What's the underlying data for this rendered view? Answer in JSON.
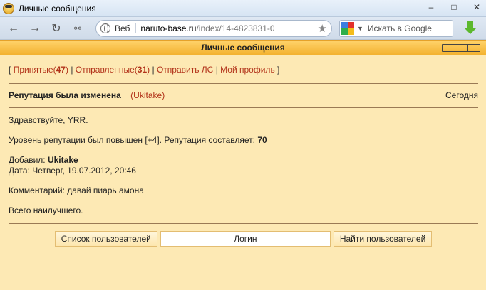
{
  "window": {
    "title": "Личные сообщения",
    "minimize": "–",
    "maximize": "□",
    "close": "✕"
  },
  "toolbar": {
    "url_label": "Веб",
    "url_host": "naruto-base.ru",
    "url_path": "/index/14-4823831-0",
    "search_placeholder": "Искать в Google"
  },
  "header": {
    "title": "Личные сообщения"
  },
  "nav": {
    "bracket_open": "[",
    "bracket_close": "]",
    "sep": "|",
    "received_label": "Принятые",
    "received_count": "47",
    "sent_label": "Отправленные",
    "sent_count": "31",
    "send_label": "Отправить ЛС",
    "profile_label": "Мой профиль"
  },
  "message": {
    "subject": "Репутация была изменена",
    "author": "Ukitake",
    "date": "Сегодня",
    "greeting": "Здравствуйте, YRR.",
    "reputation_text": "Уровень репутации был повышен [+4]. Репутация составляет:",
    "reputation_value": "70",
    "added_by_label": "Добавил:",
    "added_by": "Ukitake",
    "date_line": "Дата: Четверг, 19.07.2012, 20:46",
    "comment": "Комментарий: давай пиарь амона",
    "farewell": "Всего наилучшего."
  },
  "bottom": {
    "users_list_button": "Список пользователей",
    "login_value": "Логин",
    "find_button": "Найти пользователей"
  },
  "colors": {
    "link": "#b2331a",
    "page_bg": "#fde9b4",
    "header_bg": "#f3b22f"
  }
}
